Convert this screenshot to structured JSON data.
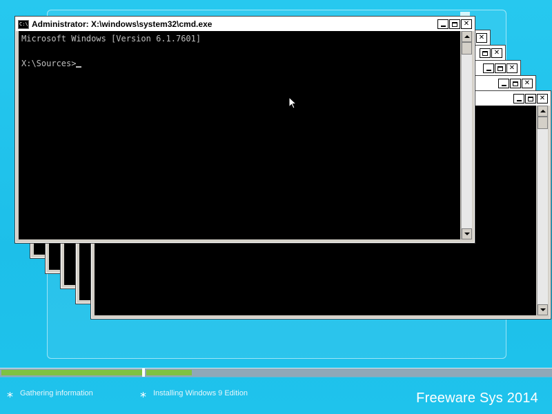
{
  "cmd_window": {
    "title": "Administrator: X:\\windows\\system32\\cmd.exe",
    "icon_label": "C:\\",
    "console_line_1": "Microsoft Windows [Version 6.1.7601]",
    "console_line_2": "",
    "console_prompt": "X:\\Sources>"
  },
  "window_controls": {
    "minimize": "minimize-icon",
    "maximize": "maximize-icon",
    "close_symbol": "✕"
  },
  "setup": {
    "steps": [
      {
        "label": "Gathering information"
      },
      {
        "label": "Installing Windows 9 Edition"
      }
    ],
    "progress": {
      "step_1_complete": 1.0,
      "step_2_fraction": 0.11
    },
    "brand": "Freeware Sys 2014"
  },
  "colors": {
    "desktop": "#1fc3ec",
    "progress_fill": "#7fc242",
    "console_bg": "#000000",
    "console_fg": "#c0c0c0"
  }
}
